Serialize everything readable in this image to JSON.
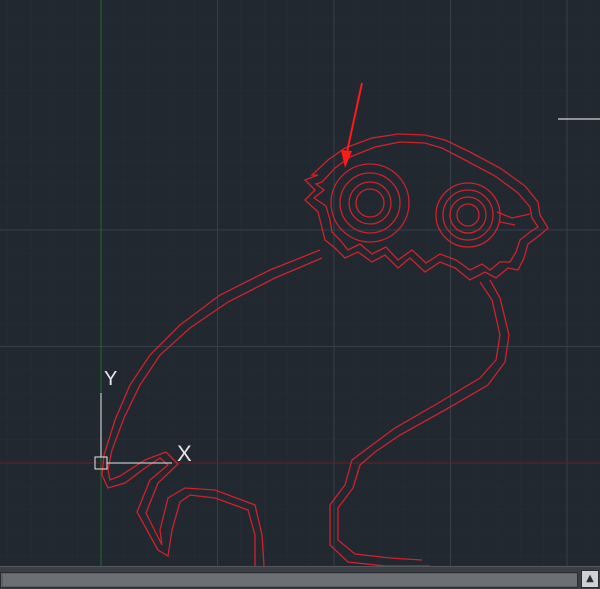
{
  "viewport": {
    "background": "#212830",
    "grid_color": "#2f3842",
    "grid_major_color": "#35404b",
    "x_axis_color": "#6b1f24",
    "y_axis_color": "#1f6b2c",
    "geometry_color": "#d0222a",
    "pointer_color": "#ff1a1a"
  },
  "ucs_icon": {
    "x_label": "X",
    "y_label": "Y",
    "color": "#e6e6e6"
  },
  "crosshair": {
    "color": "#ffffff"
  },
  "scrollbar": {
    "arrow_glyph": "▲"
  }
}
